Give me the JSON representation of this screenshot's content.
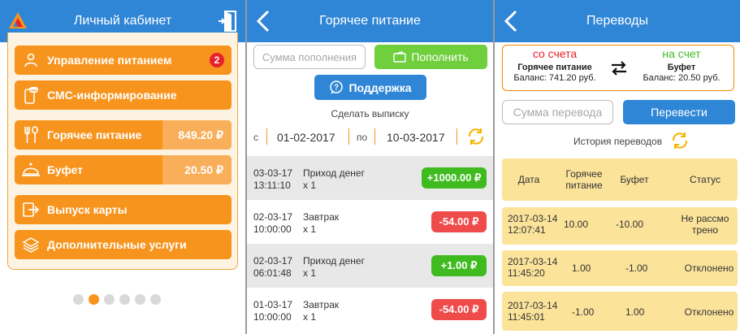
{
  "panel1": {
    "title": "Личный кабинет",
    "menu": [
      {
        "label": "Управление питанием",
        "badge": "2",
        "icon": "person-icon"
      },
      {
        "label": "СМС-информирование",
        "icon": "sms-phone-icon"
      },
      {
        "label": "Горячее питание",
        "amount": "849.20 ₽",
        "icon": "fork-spoon-icon"
      },
      {
        "label": "Буфет",
        "amount": "20.50 ₽",
        "icon": "cloche-icon"
      },
      {
        "label": "Выпуск карты",
        "icon": "card-exit-icon"
      },
      {
        "label": "Дополнительные услуги",
        "icon": "layers-icon"
      }
    ],
    "pager_active": 2,
    "pager_count": 6
  },
  "panel2": {
    "title": "Горячее питание",
    "amount_placeholder": "Сумма пополнения",
    "topup_label": "Пополнить",
    "support_label": "Поддержка",
    "statement_label": "Сделать выписку",
    "from_prefix": "с",
    "from_date": "01-02-2017",
    "to_prefix": "по",
    "to_date": "10-03-2017",
    "transactions": [
      {
        "date": "03-03-17",
        "time": "13:11:10",
        "name": "Приход денег",
        "qty": "x 1",
        "amount": "+1000.00 ₽",
        "type": "income"
      },
      {
        "date": "02-03-17",
        "time": "10:00:00",
        "name": "Завтрак",
        "qty": "x 1",
        "amount": "-54.00 ₽",
        "type": "expense"
      },
      {
        "date": "02-03-17",
        "time": "06:01:48",
        "name": "Приход денег",
        "qty": "x 1",
        "amount": "+1.00 ₽",
        "type": "income"
      },
      {
        "date": "01-03-17",
        "time": "10:00:00",
        "name": "Завтрак",
        "qty": "x 1",
        "amount": "-54.00 ₽",
        "type": "expense"
      }
    ]
  },
  "panel3": {
    "title": "Переводы",
    "from_header": "со счета",
    "from_account": "Горячее питание",
    "from_balance": "Баланс: 741.20 руб.",
    "to_header": "на счет",
    "to_account": "Буфет",
    "to_balance": "Баланс: 20.50 руб.",
    "amount_placeholder": "Сумма перевода",
    "transfer_label": "Перевести",
    "history_label": "История переводов",
    "columns": [
      "Дата",
      "Горячее питание",
      "Буфет",
      "Статус"
    ],
    "rows": [
      {
        "date": "2017-03-14 12:07:41",
        "hot": "10.00",
        "buffet": "-10.00",
        "status": "Не рассмо трено"
      },
      {
        "date": "2017-03-14 11:45:20",
        "hot": "1.00",
        "buffet": "-1.00",
        "status": "Отклонено"
      },
      {
        "date": "2017-03-14 11:45:01",
        "hot": "-1.00",
        "buffet": "1.00",
        "status": "Отклонено"
      }
    ]
  },
  "colors": {
    "header": "#2f86d6",
    "accent_orange": "#f7941d",
    "income": "#3fbb1f",
    "expense": "#ef4b4b",
    "table_bg": "#fbe39a"
  }
}
